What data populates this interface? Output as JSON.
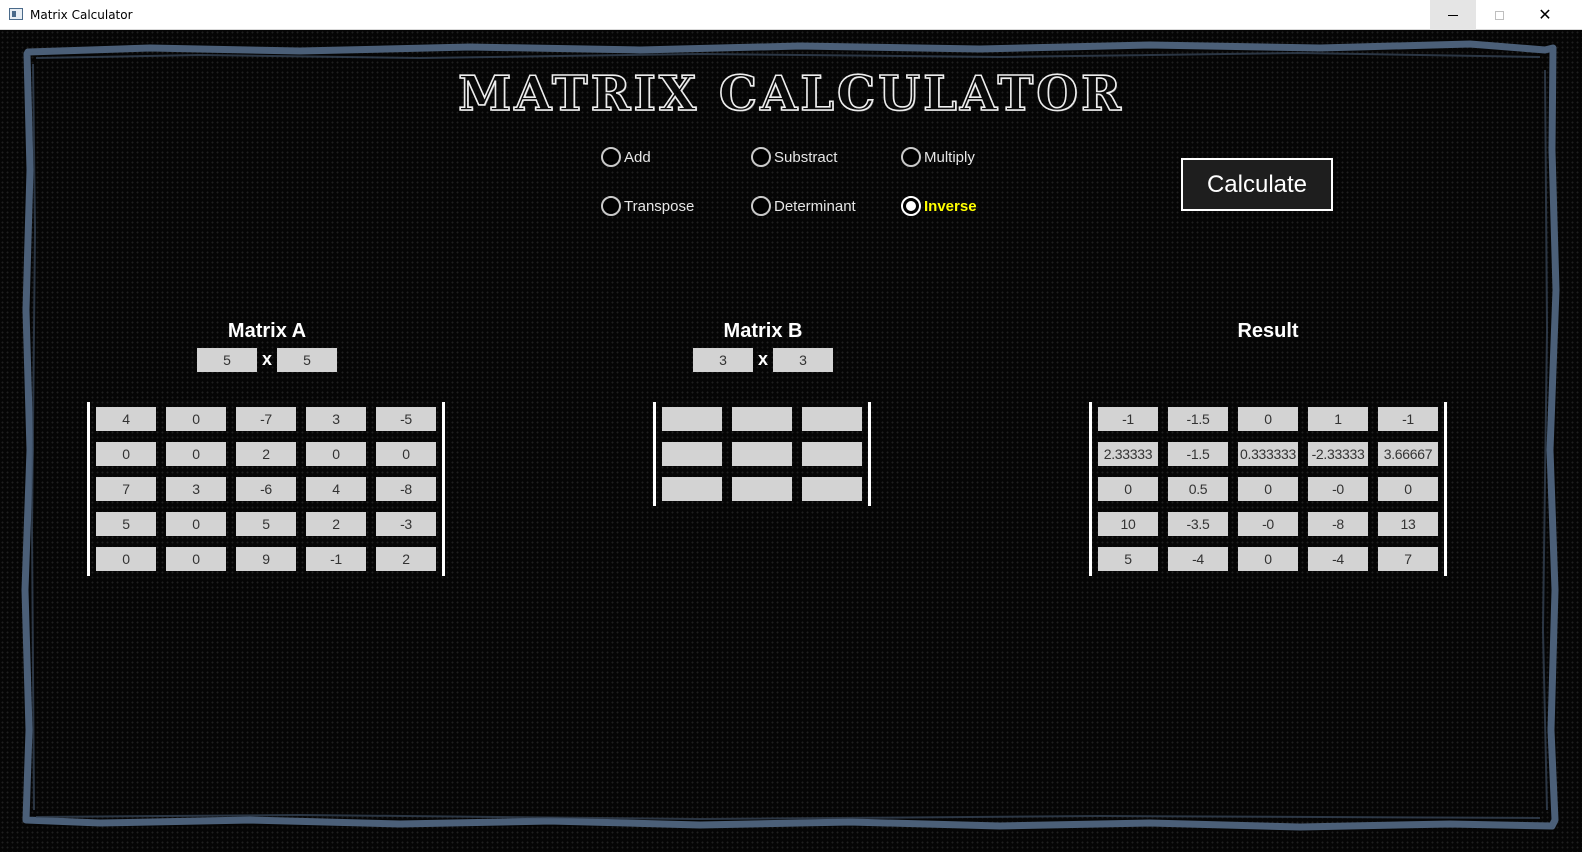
{
  "window": {
    "title": "Matrix Calculator",
    "controls": {
      "minimize": "minimize",
      "maximize": "maximize",
      "close": "✕"
    }
  },
  "app_title": "MATRIX CALCULATOR",
  "operations": [
    {
      "label": "Add",
      "checked": false
    },
    {
      "label": "Substract",
      "checked": false
    },
    {
      "label": "Multiply",
      "checked": false
    },
    {
      "label": "Transpose",
      "checked": false
    },
    {
      "label": "Determinant",
      "checked": false
    },
    {
      "label": "Inverse",
      "checked": true
    }
  ],
  "calculate_label": "Calculate",
  "matrix_a": {
    "title": "Matrix A",
    "rows_value": "5",
    "cols_value": "5",
    "separator": "x",
    "cells": [
      [
        "4",
        "0",
        "-7",
        "3",
        "-5"
      ],
      [
        "0",
        "0",
        "2",
        "0",
        "0"
      ],
      [
        "7",
        "3",
        "-6",
        "4",
        "-8"
      ],
      [
        "5",
        "0",
        "5",
        "2",
        "-3"
      ],
      [
        "0",
        "0",
        "9",
        "-1",
        "2"
      ]
    ]
  },
  "matrix_b": {
    "title": "Matrix B",
    "rows_value": "3",
    "cols_value": "3",
    "separator": "x",
    "cells": [
      [
        "",
        "",
        ""
      ],
      [
        "",
        "",
        ""
      ],
      [
        "",
        "",
        ""
      ]
    ]
  },
  "result": {
    "title": "Result",
    "cells": [
      [
        "-1",
        "-1.5",
        "0",
        "1",
        "-1"
      ],
      [
        "2.33333",
        "-1.5",
        "0.333333",
        "-2.33333",
        "3.66667"
      ],
      [
        "0",
        "0.5",
        "0",
        "-0",
        "0"
      ],
      [
        "10",
        "-3.5",
        "-0",
        "-8",
        "13"
      ],
      [
        "5",
        "-4",
        "0",
        "-4",
        "7"
      ]
    ]
  },
  "colors": {
    "background": "#000000",
    "frame": "#4b5f78",
    "cell": "#d3d3d3",
    "selected_label": "#ffff00"
  }
}
